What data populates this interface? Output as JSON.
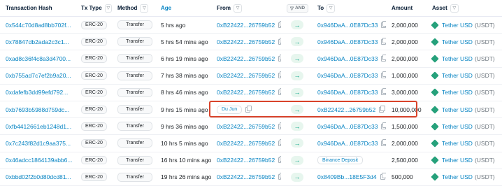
{
  "columns": {
    "hash": "Transaction Hash",
    "type": "Tx Type",
    "method": "Method",
    "age": "Age",
    "from": "From",
    "and": "AND",
    "to": "To",
    "amount": "Amount",
    "asset": "Asset"
  },
  "rows": [
    {
      "hash": "0x544c70d8ad8bb702f...",
      "type": "ERC-20",
      "method": "Transfer",
      "age": "5 hrs ago",
      "from": "0xB22422...26759b52",
      "to": "0x946DaA...0E87Dc33",
      "to_tag": false,
      "amount": "2,000,000",
      "asset": "Tether USD",
      "symbol": "(USDT)"
    },
    {
      "hash": "0x78847db2ada2c3c1...",
      "type": "ERC-20",
      "method": "Transfer",
      "age": "5 hrs 54 mins ago",
      "from": "0xB22422...26759b52",
      "to": "0x946DaA...0E87Dc33",
      "to_tag": false,
      "amount": "2,000,000",
      "asset": "Tether USD",
      "symbol": "(USDT)"
    },
    {
      "hash": "0xad8c36f4c8a3d4700...",
      "type": "ERC-20",
      "method": "Transfer",
      "age": "6 hrs 19 mins ago",
      "from": "0xB22422...26759b52",
      "to": "0x946DaA...0E87Dc33",
      "to_tag": false,
      "amount": "2,000,000",
      "asset": "Tether USD",
      "symbol": "(USDT)"
    },
    {
      "hash": "0xb755ad7c7ef2b9a20...",
      "type": "ERC-20",
      "method": "Transfer",
      "age": "7 hrs 38 mins ago",
      "from": "0xB22422...26759b52",
      "to": "0x946DaA...0E87Dc33",
      "to_tag": false,
      "amount": "1,000,000",
      "asset": "Tether USD",
      "symbol": "(USDT)"
    },
    {
      "hash": "0xdafefb3dd99efd792...",
      "type": "ERC-20",
      "method": "Transfer",
      "age": "8 hrs 46 mins ago",
      "from": "0xB22422...26759b52",
      "to": "0x946DaA...0E87Dc33",
      "to_tag": false,
      "amount": "3,000,000",
      "asset": "Tether USD",
      "symbol": "(USDT)"
    },
    {
      "hash": "0xb7693b5988d759dc...",
      "type": "ERC-20",
      "method": "Transfer",
      "age": "9 hrs 15 mins ago",
      "from": "Du Jun",
      "from_tag": true,
      "to": "0xB22422...26759b52",
      "to_tag": false,
      "amount": "10,000,000",
      "asset": "Tether USD",
      "symbol": "(USDT)"
    },
    {
      "hash": "0xfb4412661eb1248d1...",
      "type": "ERC-20",
      "method": "Transfer",
      "age": "9 hrs 36 mins ago",
      "from": "0xB22422...26759b52",
      "to": "0x946DaA...0E87Dc33",
      "to_tag": false,
      "amount": "1,500,000",
      "asset": "Tether USD",
      "symbol": "(USDT)"
    },
    {
      "hash": "0x7c243f82d1c9aa375...",
      "type": "ERC-20",
      "method": "Transfer",
      "age": "10 hrs 5 mins ago",
      "from": "0xB22422...26759b52",
      "to": "0x946DaA...0E87Dc33",
      "to_tag": false,
      "amount": "2,000,000",
      "asset": "Tether USD",
      "symbol": "(USDT)"
    },
    {
      "hash": "0x46adcc1864139abb6...",
      "type": "ERC-20",
      "method": "Transfer",
      "age": "16 hrs 10 mins ago",
      "from": "0xB22422...26759b52",
      "to": "Binance Deposit",
      "to_tag": true,
      "amount": "2,500,000",
      "asset": "Tether USD",
      "symbol": "(USDT)"
    },
    {
      "hash": "0xbbd02f2b0d80dcd81...",
      "type": "ERC-20",
      "method": "Transfer",
      "age": "19 hrs 26 mins ago",
      "from": "0xB22422...26759b52",
      "to": "0x8409Bb...18E5F3d4",
      "to_tag": false,
      "amount": "500,000",
      "asset": "Tether USD",
      "symbol": "(USDT)"
    }
  ],
  "colors": {
    "link": "#0784c3",
    "highlight": "#d9432b",
    "usdt": "#26a17b"
  }
}
